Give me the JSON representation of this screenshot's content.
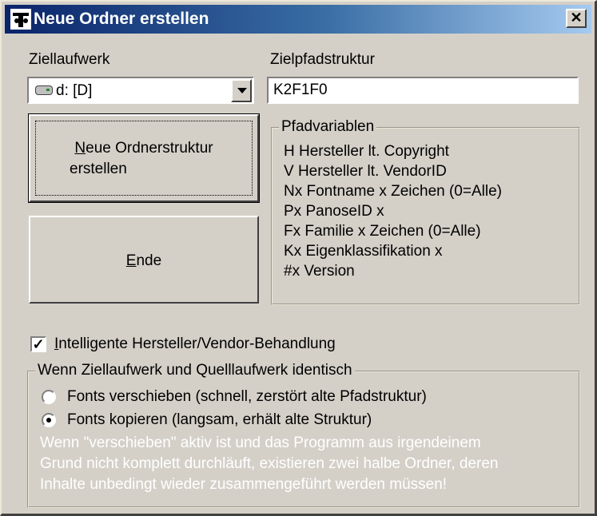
{
  "window": {
    "title": "Neue Ordner erstellen",
    "close_label": "✕"
  },
  "ziellaufwerk": {
    "label": "Ziellaufwerk",
    "selected": "d: [D]"
  },
  "zielpfad": {
    "label": "Zielpfadstruktur",
    "value": "K2F1F0"
  },
  "buttons": {
    "create_access": "N",
    "create_line1_rest": "eue Ordnerstruktur",
    "create_line2": "erstellen",
    "end_access": "E",
    "end_rest": "nde"
  },
  "pfadvariablen": {
    "title": "Pfadvariablen",
    "items": [
      "H Hersteller lt. Copyright",
      "V Hersteller lt. VendorID",
      "Nx Fontname x Zeichen (0=Alle)",
      "Px PanoseID x",
      "Fx Familie x Zeichen (0=Alle)",
      "Kx Eigenklassifikation x",
      "#x Version"
    ]
  },
  "intelligent": {
    "checked": true,
    "access": "I",
    "label_rest": "ntelligente Hersteller/Vendor-Behandlung"
  },
  "identisch": {
    "title": "Wenn Ziellaufwerk und Quelllaufwerk identisch",
    "option_move": "Fonts verschieben (schnell, zerstört alte Pfadstruktur)",
    "option_copy": "Fonts kopieren (langsam, erhält alte Struktur)",
    "selected": "copy",
    "warning_line1": "Wenn \"verschieben\" aktiv ist und das Programm aus irgendeinem",
    "warning_line2": "Grund nicht komplett durchläuft, existieren zwei halbe Ordner, deren",
    "warning_line3": "Inhalte unbedingt wieder zusammengeführt werden müssen!"
  }
}
